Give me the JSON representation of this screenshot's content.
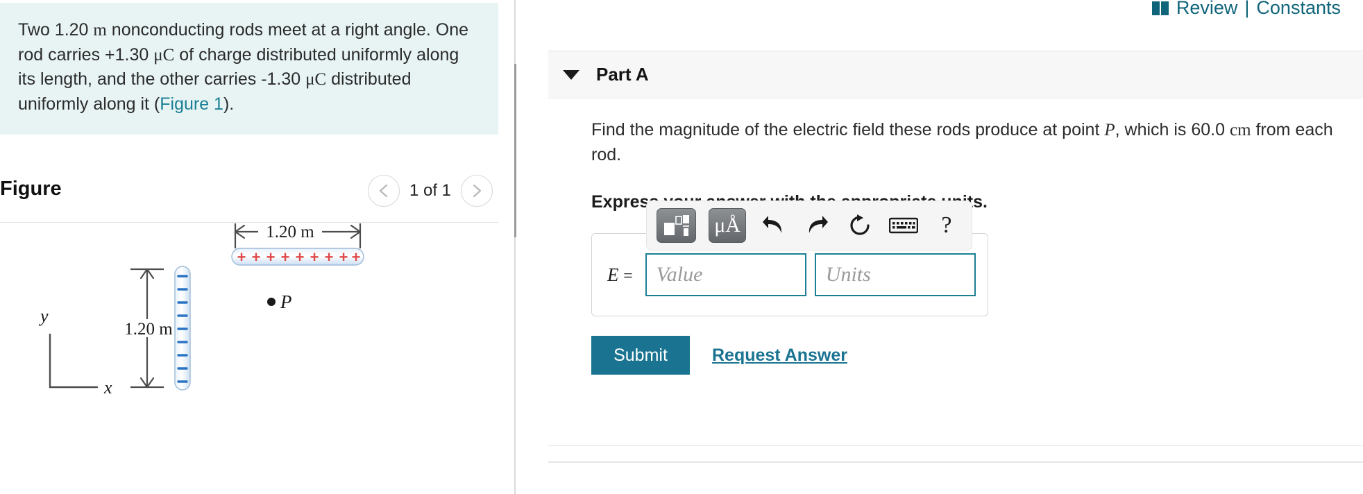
{
  "problem": {
    "text_parts": [
      "Two 1.20 ",
      "m",
      " nonconducting rods meet at a right angle. One rod carries +1.30 ",
      "μC",
      " of charge distributed uniformly along its length, and the other carries -1.30 ",
      "μC",
      " distributed uniformly along it (",
      "Figure 1",
      ")."
    ],
    "line1_a": "Two 1.20 ",
    "unit_m": "m",
    "line1_b": " nonconducting rods meet at a right angle. One rod carries +1.30 ",
    "unit_uc1": "μC",
    "line2_b": " of charge distributed uniformly along its length, and the other carries -1.30 ",
    "unit_uc2": "μC",
    "line3_b": " distributed uniformly along it (",
    "figure_link": "Figure 1",
    "line3_c": ")."
  },
  "figure": {
    "title": "Figure",
    "counter": "1 of 1",
    "prev_icon": "chevron-left-icon",
    "next_icon": "chevron-right-icon",
    "horizontal_label": "1.20 m",
    "vertical_label": "1.20 m",
    "point_label": "P",
    "axis_y": "y",
    "axis_x": "x",
    "positive_sign": "+",
    "negative_sign": "–",
    "positive_count": 9,
    "negative_count": 10,
    "rod_fill": "#dce9f7",
    "plus_color": "#e04a4a",
    "minus_color": "#2a74c4"
  },
  "header": {
    "review_label": "Review",
    "separator": "|",
    "constants_label": "Constants",
    "book_icon": "book-icon",
    "accent_color": "#10657a"
  },
  "part": {
    "label": "Part A",
    "caret_icon": "caret-down-icon",
    "question_a": "Find the magnitude of the electric field these rods produce at point ",
    "question_var": "P",
    "question_b": ", which is 60.0 ",
    "question_unit": "cm",
    "question_c": " from each rod.",
    "express": "Express your answer with the appropriate units."
  },
  "answer": {
    "variable": "E",
    "equals": "=",
    "value_placeholder": "Value",
    "units_placeholder": "Units",
    "value": "",
    "units": "",
    "accent_color": "#1a7f94"
  },
  "toolbar": {
    "items": [
      {
        "name": "template-fraction-button",
        "icon": "math-template-icon",
        "label": ""
      },
      {
        "name": "units-button",
        "icon": "micro-angstrom-icon",
        "label": "μÅ"
      },
      {
        "name": "undo-button",
        "icon": "undo-arrow-icon",
        "label": ""
      },
      {
        "name": "redo-button",
        "icon": "redo-arrow-icon",
        "label": ""
      },
      {
        "name": "reset-button",
        "icon": "refresh-circle-icon",
        "label": ""
      },
      {
        "name": "keyboard-button",
        "icon": "keyboard-icon",
        "label": ""
      },
      {
        "name": "help-button",
        "icon": "question-mark-icon",
        "label": "?"
      }
    ],
    "mu_text": "μÅ",
    "help_text": "?"
  },
  "actions": {
    "submit_label": "Submit",
    "request_answer_label": "Request Answer",
    "submit_color": "#1a7491"
  }
}
